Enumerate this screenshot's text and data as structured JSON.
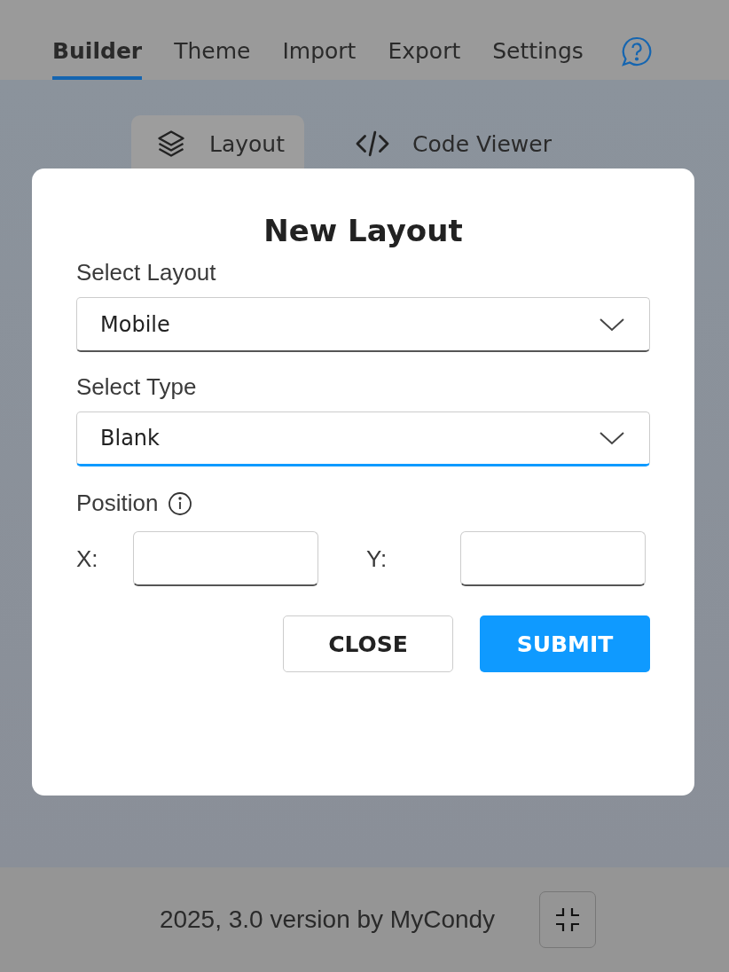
{
  "tabs": [
    {
      "label": "Builder",
      "selected": true
    },
    {
      "label": "Theme",
      "selected": false
    },
    {
      "label": "Import",
      "selected": false
    },
    {
      "label": "Export",
      "selected": false
    },
    {
      "label": "Settings",
      "selected": false
    }
  ],
  "subtabs": [
    {
      "label": "Layout",
      "kind": "layers",
      "selected": true
    },
    {
      "label": "Code Viewer",
      "kind": "code",
      "selected": false
    }
  ],
  "dialog": {
    "title": "New Layout",
    "selects": [
      {
        "label": "Select Layout",
        "value": "Mobile",
        "focused": false
      },
      {
        "label": "Select Type",
        "value": "Blank",
        "focused": true
      }
    ],
    "position": {
      "label": "Position",
      "fields": [
        {
          "label": "X:"
        },
        {
          "label": "Y:"
        }
      ]
    },
    "buttons": [
      {
        "label": "CLOSE",
        "kind": "secondary"
      },
      {
        "label": "SUBMIT",
        "kind": "primary"
      }
    ]
  },
  "footer": {
    "text": "2025, 3.0 version by MyCondy"
  }
}
